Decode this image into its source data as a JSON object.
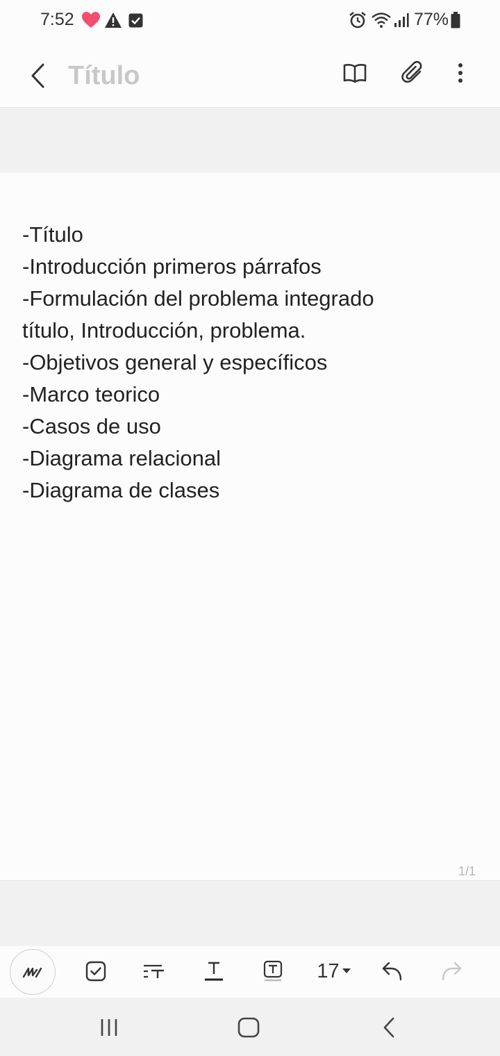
{
  "status_bar": {
    "time": "7:52",
    "battery": "77%",
    "left_icons": [
      "heart-icon",
      "warning-icon",
      "checkbox-notification-icon"
    ],
    "right_icons": [
      "alarm-icon",
      "wifi-icon",
      "signal-icon",
      "battery-icon"
    ],
    "heart_color": "#f0506e"
  },
  "app_bar": {
    "title_placeholder": "Título"
  },
  "note": {
    "lines": [
      "-Título",
      "-Introducción primeros párrafos",
      "-Formulación del problema integrado",
      "título, Introducción, problema.",
      "-Objetivos general y específicos",
      "-Marco teorico",
      "-Casos de uso",
      "-Diagrama relacional",
      "-Diagrama de clases"
    ],
    "page_indicator": "1/1"
  },
  "toolbar": {
    "font_size": "17",
    "items": [
      "pen-icon",
      "checkbox-icon",
      "text-style-icon",
      "text-color-icon",
      "text-background-icon",
      "font-size",
      "undo-icon",
      "redo-icon"
    ]
  },
  "nav_bar": {
    "items": [
      "recents-icon",
      "home-icon",
      "back-icon"
    ]
  }
}
